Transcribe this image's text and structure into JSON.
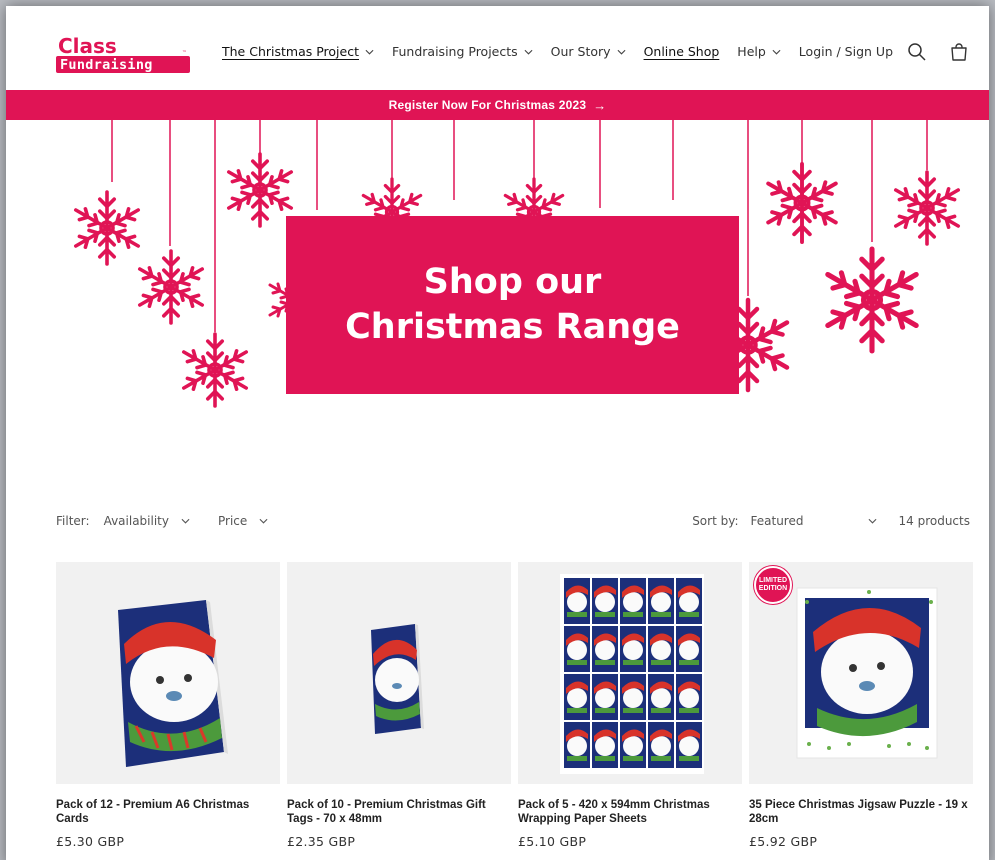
{
  "logo": {
    "line1": "Class",
    "line2": "Fundraising",
    "tm": "™"
  },
  "nav": [
    {
      "label": "The Christmas Project",
      "dropdown": true,
      "underline": true
    },
    {
      "label": "Fundraising Projects",
      "dropdown": true,
      "underline": false
    },
    {
      "label": "Our Story",
      "dropdown": true,
      "underline": false
    },
    {
      "label": "Online Shop",
      "dropdown": false,
      "underline": true
    },
    {
      "label": "Help",
      "dropdown": true,
      "underline": false
    },
    {
      "label": "Login / Sign Up",
      "dropdown": false,
      "underline": false
    }
  ],
  "icons": {
    "search": "search-icon",
    "cart": "cart-icon"
  },
  "announcement": {
    "text": "Register Now For Christmas 2023",
    "arrow": "→"
  },
  "hero": {
    "line1": "Shop our",
    "line2": "Christmas Range"
  },
  "filters": {
    "label": "Filter:",
    "availability": "Availability",
    "price": "Price",
    "sort_label": "Sort by:",
    "sort_value": "Featured",
    "count": "14 products"
  },
  "products": [
    {
      "title": "Pack of 12 - Premium A6 Christmas Cards",
      "price": "£5.30 GBP"
    },
    {
      "title": "Pack of 10 - Premium Christmas Gift Tags - 70 x 48mm",
      "price": "£2.35 GBP"
    },
    {
      "title": "Pack of 5 - 420 x 594mm Christmas Wrapping Paper Sheets",
      "price": "£5.10 GBP"
    },
    {
      "title": "35 Piece Christmas Jigsaw Puzzle - 19 x 28cm",
      "price": "£5.92 GBP",
      "badge_line1": "LIMITED",
      "badge_line2": "EDITION"
    }
  ],
  "colors": {
    "brand": "#e01455",
    "text": "#222222"
  }
}
